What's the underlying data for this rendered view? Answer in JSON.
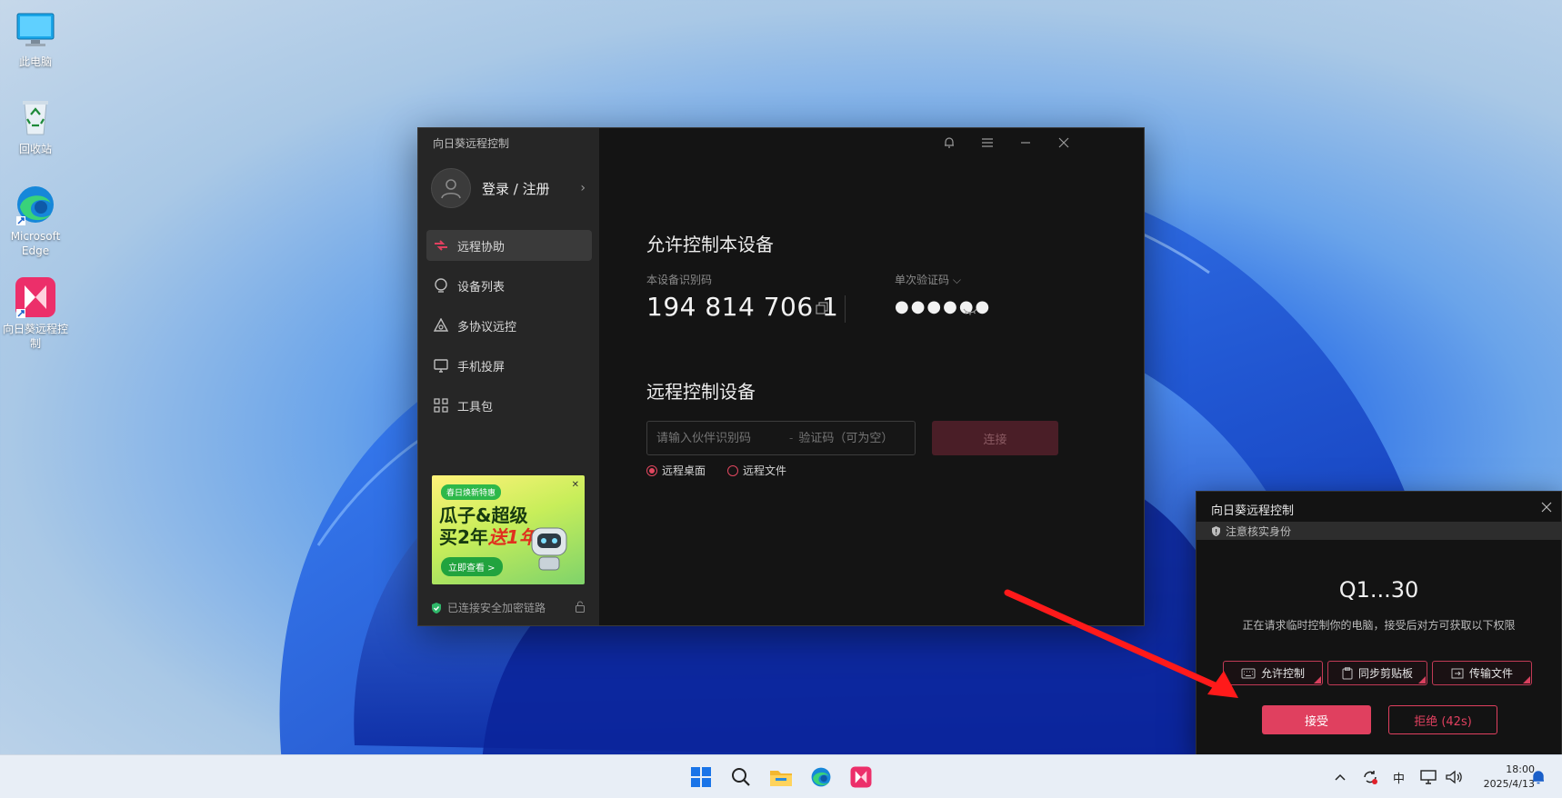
{
  "desktop": {
    "icons": [
      {
        "label": "此电脑"
      },
      {
        "label": "回收站"
      },
      {
        "label": "Microsoft Edge"
      },
      {
        "label": "向日葵远程控制"
      }
    ]
  },
  "app": {
    "title": "向日葵远程控制",
    "login_label": "登录 / 注册",
    "nav": [
      {
        "label": "远程协助",
        "icon": "remote-assist-icon"
      },
      {
        "label": "设备列表",
        "icon": "device-list-icon"
      },
      {
        "label": "多协议远控",
        "icon": "multi-protocol-icon"
      },
      {
        "label": "手机投屏",
        "icon": "phone-cast-icon"
      },
      {
        "label": "工具包",
        "icon": "toolbox-icon"
      }
    ],
    "ad": {
      "badge": "春日焕新特惠",
      "line1": "瓜子&超级",
      "line2_a": "买2年",
      "line2_b": "送1年",
      "cta": "立即查看 >"
    },
    "secure_text": "已连接安全加密链路",
    "allow_section": {
      "title": "允许控制本设备",
      "device_id_label": "本设备识别码",
      "device_id": "194 814 706 1",
      "code_label": "单次验证码 ⌵",
      "code_masked": "●●●●●●"
    },
    "remote_section": {
      "title": "远程控制设备",
      "partner_placeholder": "请输入伙伴识别码",
      "code_placeholder": "验证码（可为空）",
      "connect_label": "连接",
      "mode_desktop": "远程桌面",
      "mode_file": "远程文件"
    }
  },
  "popup": {
    "title": "向日葵远程控制",
    "warning": "注意核实身份",
    "requester": "Q1...30",
    "description": "正在请求临时控制你的电脑，接受后对方可获取以下权限",
    "permissions": [
      {
        "label": "允许控制",
        "icon": "keyboard-icon"
      },
      {
        "label": "同步剪贴板",
        "icon": "clipboard-icon"
      },
      {
        "label": "传输文件",
        "icon": "file-transfer-icon"
      }
    ],
    "accept_label": "接受",
    "reject_label": "拒绝 (42s)",
    "accent": "#e0405f"
  },
  "taskbar": {
    "tray_lang": "中",
    "time": "18:00",
    "date": "2025/4/13"
  }
}
